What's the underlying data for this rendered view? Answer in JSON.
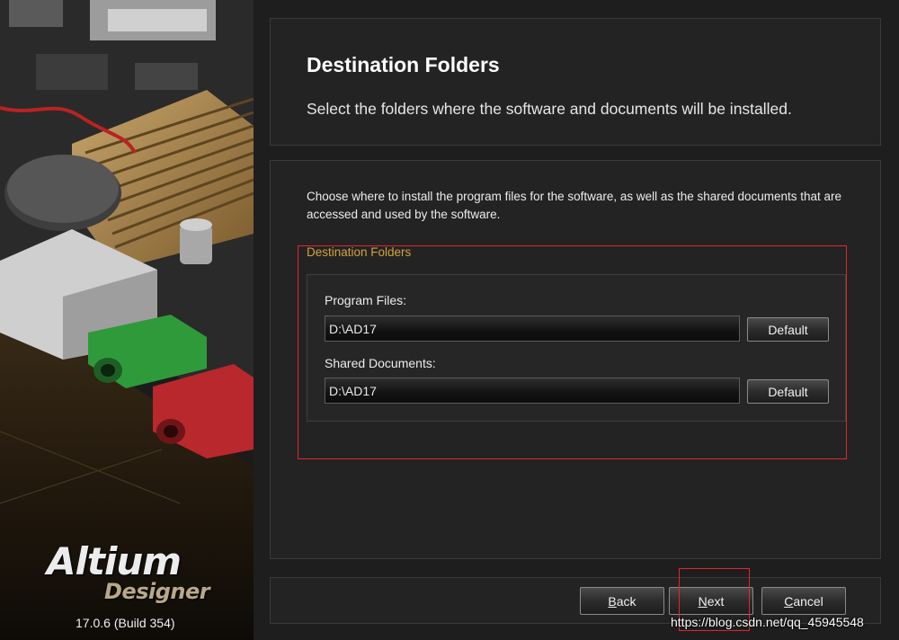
{
  "branding": {
    "logo_line1": "Altium",
    "logo_line2": "Designer",
    "version": "17.0.6 (Build 354)"
  },
  "header": {
    "title": "Destination Folders",
    "subtitle": "Select the folders where the software and documents will be installed."
  },
  "content": {
    "description": "Choose where to install the program files for the software, as well as the shared documents that are accessed and used by the software.",
    "group_label": "Destination Folders",
    "program_files": {
      "label": "Program Files:",
      "value": "D:\\AD17",
      "default_button": "Default"
    },
    "shared_documents": {
      "label": "Shared Documents:",
      "value": "D:\\AD17",
      "default_button": "Default"
    }
  },
  "footer": {
    "back_first": "B",
    "back_rest": "ack",
    "next_first": "N",
    "next_rest": "ext",
    "cancel_first": "C",
    "cancel_rest": "ancel"
  },
  "watermark": "https://blog.csdn.net/qq_45945548",
  "colors": {
    "accent": "#d4a33a",
    "highlight": "#e0262e",
    "background": "#1e1e1e",
    "panel": "#232323"
  }
}
